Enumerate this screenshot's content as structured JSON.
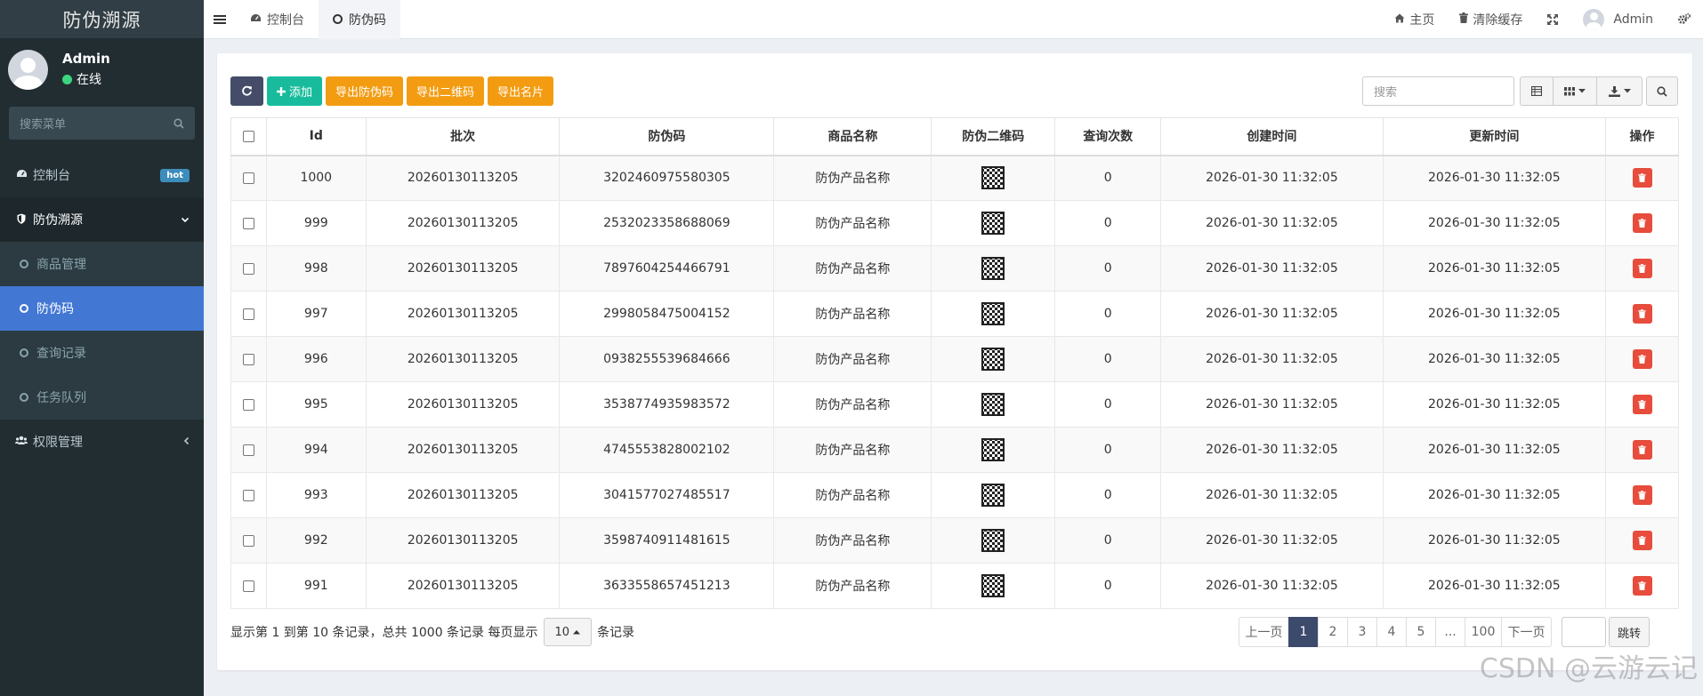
{
  "sidebar": {
    "brand": "防伪溯源",
    "user": {
      "name": "Admin",
      "status": "在线"
    },
    "search_placeholder": "搜索菜单",
    "items": [
      {
        "label": "控制台",
        "icon": "dashboard-icon",
        "badge": "hot"
      },
      {
        "label": "防伪溯源",
        "icon": "shield-icon",
        "expanded": true,
        "children": [
          {
            "label": "商品管理"
          },
          {
            "label": "防伪码",
            "active": true
          },
          {
            "label": "查询记录"
          },
          {
            "label": "任务队列"
          }
        ]
      },
      {
        "label": "权限管理",
        "icon": "users-icon"
      }
    ]
  },
  "header": {
    "tabs": [
      {
        "label": "控制台",
        "icon": "dashboard-icon"
      },
      {
        "label": "防伪码",
        "active": true
      }
    ],
    "home_label": "主页",
    "clear_cache_label": "清除缓存",
    "user_label": "Admin"
  },
  "toolbar": {
    "add_label": "添加",
    "export_codes_label": "导出防伪码",
    "export_qrcode_label": "导出二维码",
    "export_card_label": "导出名片",
    "search_placeholder": "搜索"
  },
  "table": {
    "columns": [
      "Id",
      "批次",
      "防伪码",
      "商品名称",
      "防伪二维码",
      "查询次数",
      "创建时间",
      "更新时间",
      "操作"
    ],
    "rows": [
      {
        "id": "1000",
        "batch": "20260130113205",
        "code": "3202460975580305",
        "product": "防伪产品名称",
        "queries": "0",
        "created": "2026-01-30 11:32:05",
        "updated": "2026-01-30 11:32:05"
      },
      {
        "id": "999",
        "batch": "20260130113205",
        "code": "2532023358688069",
        "product": "防伪产品名称",
        "queries": "0",
        "created": "2026-01-30 11:32:05",
        "updated": "2026-01-30 11:32:05"
      },
      {
        "id": "998",
        "batch": "20260130113205",
        "code": "7897604254466791",
        "product": "防伪产品名称",
        "queries": "0",
        "created": "2026-01-30 11:32:05",
        "updated": "2026-01-30 11:32:05"
      },
      {
        "id": "997",
        "batch": "20260130113205",
        "code": "2998058475004152",
        "product": "防伪产品名称",
        "queries": "0",
        "created": "2026-01-30 11:32:05",
        "updated": "2026-01-30 11:32:05"
      },
      {
        "id": "996",
        "batch": "20260130113205",
        "code": "0938255539684666",
        "product": "防伪产品名称",
        "queries": "0",
        "created": "2026-01-30 11:32:05",
        "updated": "2026-01-30 11:32:05"
      },
      {
        "id": "995",
        "batch": "20260130113205",
        "code": "3538774935983572",
        "product": "防伪产品名称",
        "queries": "0",
        "created": "2026-01-30 11:32:05",
        "updated": "2026-01-30 11:32:05"
      },
      {
        "id": "994",
        "batch": "20260130113205",
        "code": "4745553828002102",
        "product": "防伪产品名称",
        "queries": "0",
        "created": "2026-01-30 11:32:05",
        "updated": "2026-01-30 11:32:05"
      },
      {
        "id": "993",
        "batch": "20260130113205",
        "code": "3041577027485517",
        "product": "防伪产品名称",
        "queries": "0",
        "created": "2026-01-30 11:32:05",
        "updated": "2026-01-30 11:32:05"
      },
      {
        "id": "992",
        "batch": "20260130113205",
        "code": "3598740911481615",
        "product": "防伪产品名称",
        "queries": "0",
        "created": "2026-01-30 11:32:05",
        "updated": "2026-01-30 11:32:05"
      },
      {
        "id": "991",
        "batch": "20260130113205",
        "code": "3633558657451213",
        "product": "防伪产品名称",
        "queries": "0",
        "created": "2026-01-30 11:32:05",
        "updated": "2026-01-30 11:32:05"
      }
    ]
  },
  "footer": {
    "info_prefix": "显示第 1 到第 10 条记录，总共 1000 条记录 每页显示",
    "page_size": "10",
    "info_suffix": "条记录",
    "pagination": {
      "prev": "上一页",
      "pages": [
        "1",
        "2",
        "3",
        "4",
        "5",
        "...",
        "100"
      ],
      "current": "1",
      "next": "下一页",
      "jump": "跳转"
    }
  },
  "watermark": "CSDN @云游云记",
  "colors": {
    "sidebar_bg": "#222d32",
    "active_menu": "#4377d4",
    "add_button": "#18bc9c",
    "export_button": "#f39c12",
    "delete_button": "#e74c3c",
    "pager_active": "#3c4a6c"
  }
}
